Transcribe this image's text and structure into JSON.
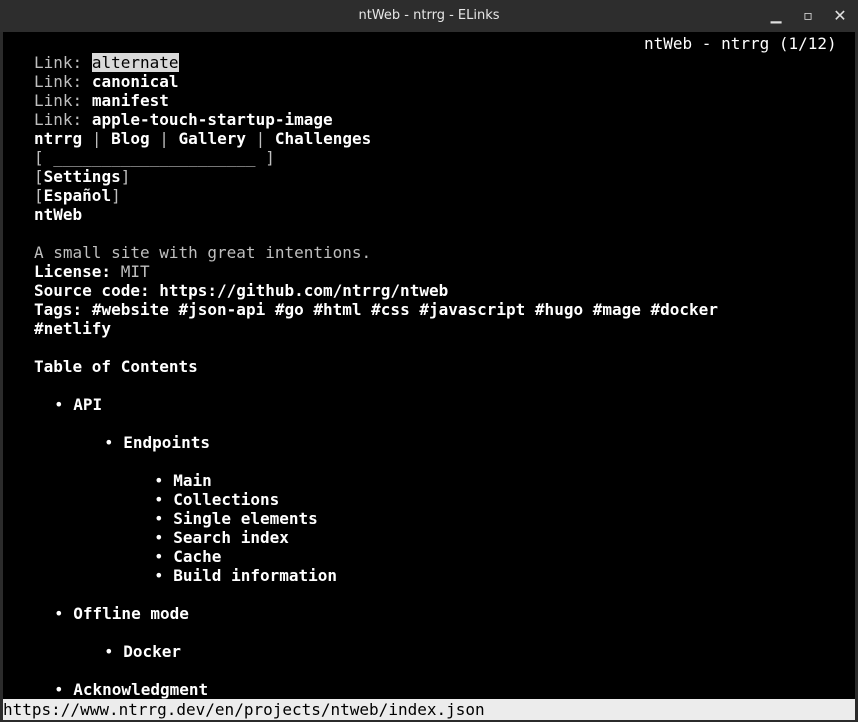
{
  "window": {
    "title": "ntWeb - ntrrg - ELinks"
  },
  "page": {
    "header": "ntWeb - ntrrg (1/12)"
  },
  "links": {
    "label": "Link:",
    "items": [
      "alternate",
      "canonical",
      "manifest",
      "apple-touch-startup-image"
    ]
  },
  "nav": {
    "items": [
      "ntrrg",
      "Blog",
      "Gallery",
      "Challenges"
    ],
    "separator": "|"
  },
  "search": {
    "field": "[ _____________________ ]"
  },
  "buttons": {
    "settings": "Settings",
    "language": "Español"
  },
  "content": {
    "title": "ntWeb",
    "description": "A small site with great intentions.",
    "license_label": "License:",
    "license_value": "MIT",
    "source_label": "Source code:",
    "source_url": "https://github.com/ntrrg/ntweb",
    "tags_label": "Tags:",
    "tags_line1": "#website #json-api #go #html #css #javascript #hugo #mage #docker",
    "tags_line2": "#netlify"
  },
  "toc": {
    "title": "Table of Contents",
    "api": "API",
    "endpoints": "Endpoints",
    "endpoint_items": [
      "Main",
      "Collections",
      "Single elements",
      "Search index",
      "Cache",
      "Build information"
    ],
    "offline": "Offline mode",
    "docker": "Docker",
    "acknowledgment": "Acknowledgment"
  },
  "status": {
    "url": "https://www.ntrrg.dev/en/projects/ntweb/index.json"
  }
}
